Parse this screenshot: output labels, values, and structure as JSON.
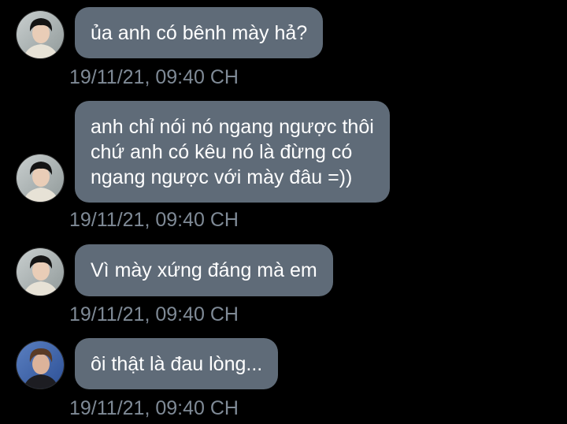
{
  "theme": {
    "background": "#000000",
    "bubble_color": "#5f6b78",
    "bubble_text_color": "#ffffff",
    "timestamp_color": "#7f8a96"
  },
  "messages": [
    {
      "avatar": "avatar-dark-hair-boy",
      "text": "ủa anh có bênh mày hả?",
      "timestamp": "19/11/21, 09:40 CH"
    },
    {
      "avatar": "avatar-dark-hair-boy",
      "text": "anh chỉ nói nó ngang ngược thôi\nchứ anh có kêu nó là đừng có\nngang ngược với mày đâu =))",
      "timestamp": "19/11/21, 09:40 CH"
    },
    {
      "avatar": "avatar-dark-hair-boy",
      "text": "Vì mày xứng đáng mà em",
      "timestamp": "19/11/21, 09:40 CH"
    },
    {
      "avatar": "avatar-brown-hair-boy",
      "text": "ôi thật là đau lòng...",
      "timestamp": "19/11/21, 09:40 CH"
    }
  ]
}
